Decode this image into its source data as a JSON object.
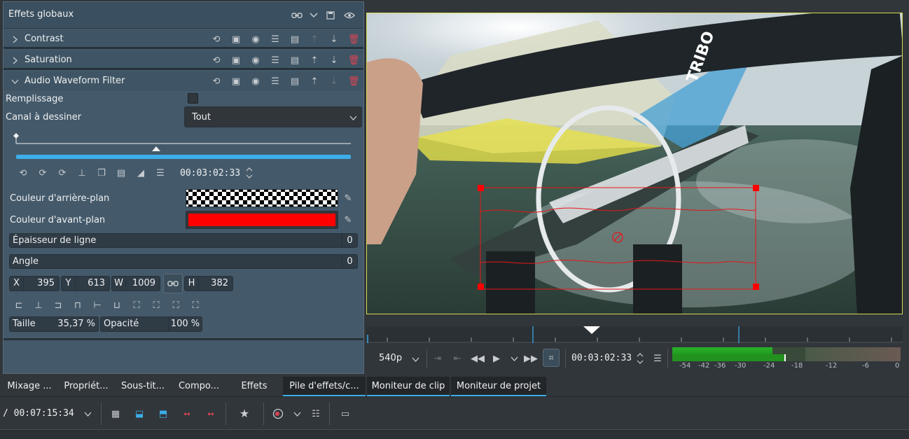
{
  "panel": {
    "title": "Effets globaux",
    "effects": [
      {
        "name": "Contrast",
        "expanded": false
      },
      {
        "name": "Saturation",
        "expanded": false
      },
      {
        "name": "Audio Waveform Filter",
        "expanded": true
      }
    ]
  },
  "filter": {
    "fill_label": "Remplissage",
    "fill_checked": false,
    "channel_label": "Canal à dessiner",
    "channel_value": "Tout",
    "keyframe_timecode": "00:03:02:33",
    "bg_color_label": "Couleur d'arrière-plan",
    "fg_color_label": "Couleur d'avant-plan",
    "fg_color": "#ff0000",
    "line_width_label": "Épaisseur de ligne",
    "line_width_value": "0",
    "angle_label": "Angle",
    "angle_value": "0",
    "geometry": {
      "x_label": "X",
      "x": "395",
      "y_label": "Y",
      "y": "613",
      "w_label": "W",
      "w": "1009",
      "h_label": "H",
      "h": "382"
    },
    "size_label": "Taille",
    "size_value": "35,37 %",
    "opacity_label": "Opacité",
    "opacity_value": "100 %"
  },
  "monitor": {
    "resolution": "540p",
    "timecode": "00:03:02:33",
    "audio_meter_ticks": [
      "-54",
      "-42",
      "-36",
      "-30",
      "-24",
      "-18",
      "-12",
      "-6",
      "0"
    ],
    "audio_level_fraction": 0.44,
    "video_overlay_text": "TRIBO"
  },
  "tabs": {
    "left": [
      "Mixage ...",
      "Propriét...",
      "Sous-tit...",
      "Compo...",
      "Effets",
      "Pile d'effets/c..."
    ],
    "right": [
      "Moniteur de clip",
      "Moniteur de projet"
    ]
  },
  "timeline": {
    "duration": "/ 00:07:15:34"
  },
  "colors": {
    "accent": "#3daee9",
    "selection_box": "#e8161a",
    "meter_green": "#1ea51e"
  }
}
